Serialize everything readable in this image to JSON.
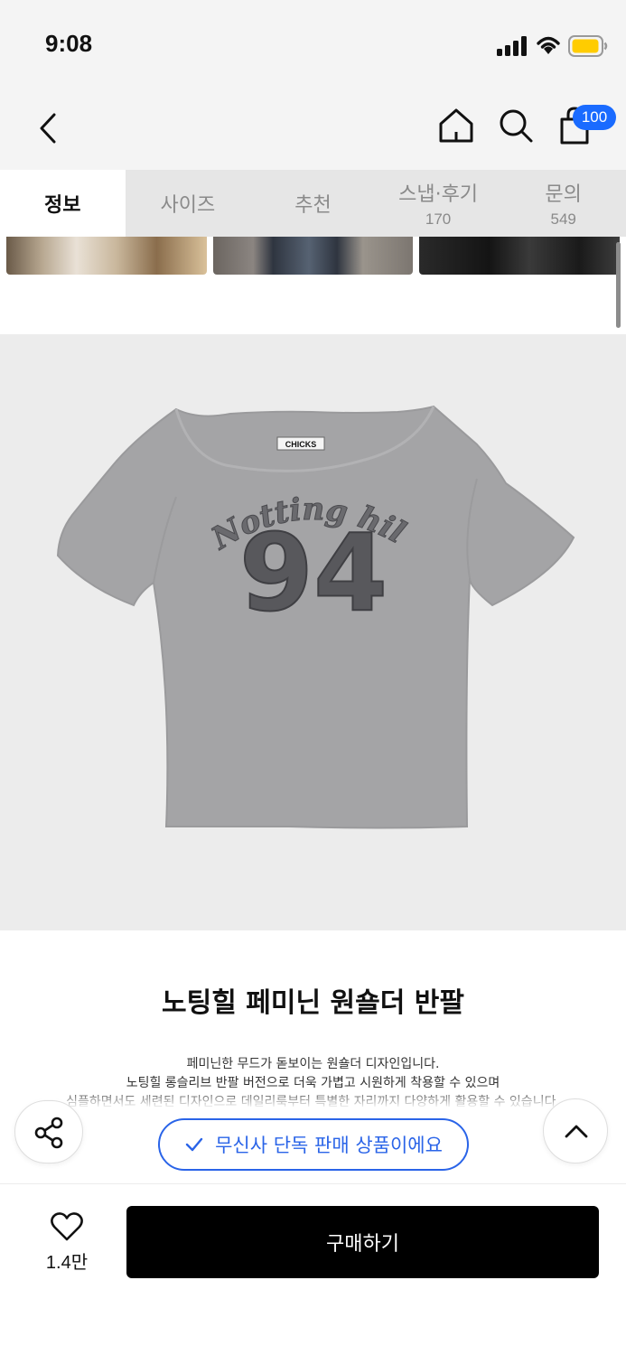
{
  "status_bar": {
    "time": "9:08"
  },
  "header": {
    "cart_count": "100"
  },
  "tabs": [
    {
      "label": "정보",
      "count": ""
    },
    {
      "label": "사이즈",
      "count": ""
    },
    {
      "label": "추천",
      "count": ""
    },
    {
      "label": "스냅·후기",
      "count": "170"
    },
    {
      "label": "문의",
      "count": "549"
    }
  ],
  "product": {
    "brand_tag": "CHICKS",
    "print_text": "Notting hill",
    "print_number": "94",
    "title": "노팅힐 페미닌 원숄더 반팔",
    "description": [
      "페미닌한 무드가 돋보이는 원숄더 디자인입니다.",
      "노팅힐 롱슬리브 반팔 버전으로 더욱 가볍고 시원하게 착용할 수 있으며",
      "심플하면서도 세련된 디자인으로 데일리룩부터 특별한 자리까지 다양하게 활용할 수 있습니다."
    ]
  },
  "exclusive_label": "무신사 단독 판매 상품이에요",
  "bottom_bar": {
    "like_count": "1.4만",
    "buy_label": "구매하기"
  },
  "colors": {
    "accent_blue": "#2a64e8",
    "badge_blue": "#1a6bff",
    "buy_button": "#000000"
  },
  "icons": [
    "back-icon",
    "home-icon",
    "search-icon",
    "cart-icon",
    "share-icon",
    "check-icon",
    "chevron-up-icon",
    "heart-icon",
    "signal-icon",
    "wifi-icon",
    "battery-icon"
  ]
}
